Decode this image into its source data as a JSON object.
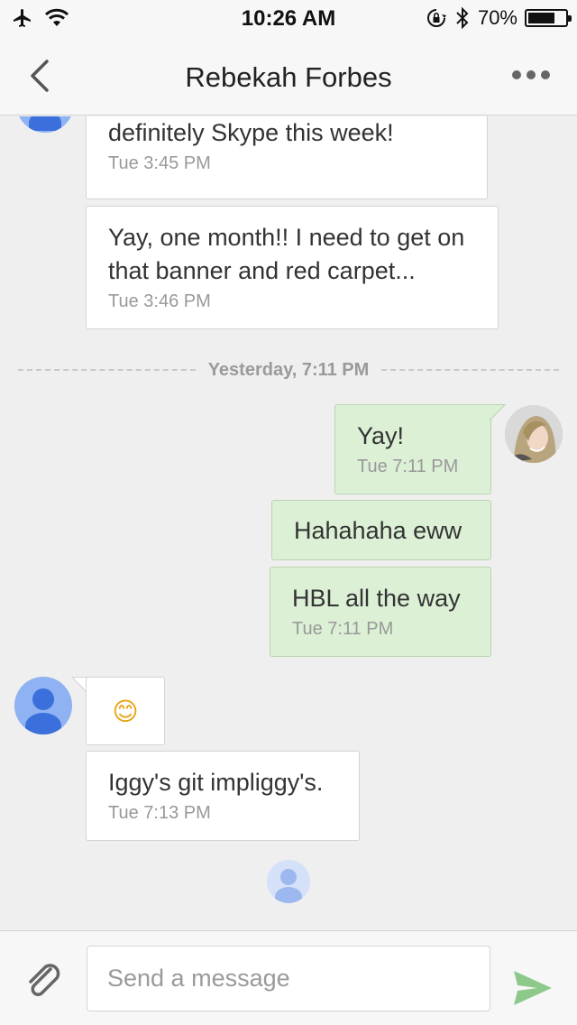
{
  "status_bar": {
    "time": "10:26 AM",
    "battery_percent": "70%",
    "battery_level": 0.7,
    "icons": [
      "airplane-icon",
      "wifi-icon",
      "rotation-lock-icon",
      "bluetooth-icon",
      "battery-icon"
    ]
  },
  "nav": {
    "title": "Rebekah Forbes",
    "back_icon": "chevron-left-icon",
    "more_icon": "more-horizontal-icon"
  },
  "messages": [
    {
      "direction": "in",
      "text": "Androids are way better!!! I can definitely Skype this week!",
      "time": "Tue 3:45 PM"
    },
    {
      "direction": "in",
      "text": "Yay, one month!! I need to get on that banner and red carpet...",
      "time": "Tue 3:46 PM"
    },
    {
      "direction": "out",
      "text": "Yay!",
      "time": "Tue 7:11 PM"
    },
    {
      "direction": "out",
      "text": "Hahahaha eww",
      "time": ""
    },
    {
      "direction": "out",
      "text": "HBL all the way",
      "time": "Tue 7:11 PM"
    },
    {
      "direction": "in",
      "text": "😊",
      "time": ""
    },
    {
      "direction": "in",
      "text": "Iggy's git impliggy's.",
      "time": "Tue 7:13 PM"
    }
  ],
  "divider": {
    "label": "Yesterday, 7:11 PM"
  },
  "compose": {
    "placeholder": "Send a message",
    "attach_icon": "paperclip-icon",
    "send_icon": "send-icon",
    "send_color": "#8dc98a"
  },
  "colors": {
    "outgoing_bubble": "#dcf0d6",
    "incoming_bubble": "#ffffff",
    "avatar_blue": "#3a6fdc"
  }
}
